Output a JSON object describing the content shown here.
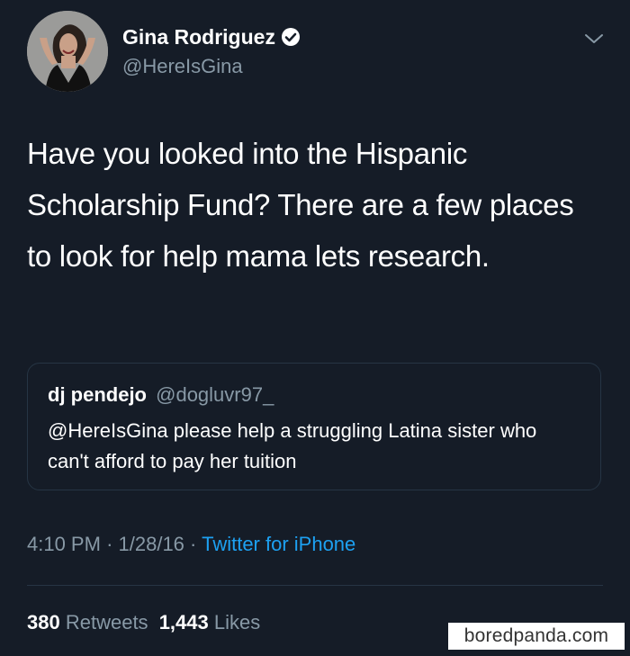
{
  "tweet": {
    "author": {
      "name": "Gina Rodriguez",
      "handle": "@HereIsGina",
      "verified": true
    },
    "text": "Have you looked into the Hispanic Scholarship Fund? There are a few places to look for help mama lets research.",
    "quoted": {
      "name": "dj pendejo",
      "handle": "@dogluvr97_",
      "text": "@HereIsGina please help a struggling Latina sister who can't afford to pay her tuition"
    },
    "time": "4:10 PM",
    "date": "1/28/16",
    "separator": "·",
    "source": "Twitter for iPhone",
    "stats": {
      "retweets_count": "380",
      "retweets_label": "Retweets",
      "likes_count": "1,443",
      "likes_label": "Likes"
    }
  },
  "watermark": "boredpanda.com",
  "icons": {
    "verified": "verified-badge-icon",
    "menu": "chevron-down-icon"
  },
  "colors": {
    "background": "#151c27",
    "text": "#ffffff",
    "muted": "#8899a6",
    "link": "#1da1f2",
    "border": "#263544"
  }
}
